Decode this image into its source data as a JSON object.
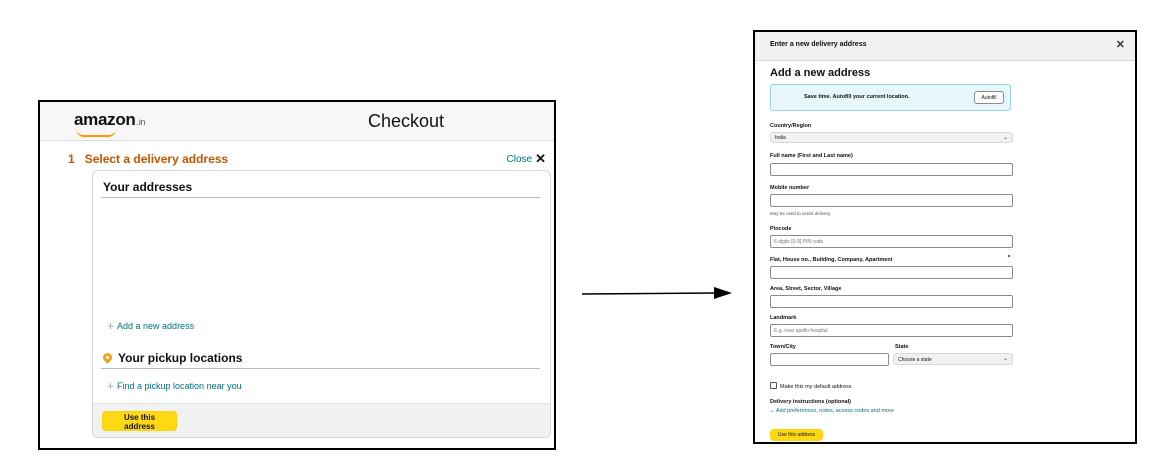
{
  "left": {
    "logo": "amazon",
    "logo_tld": ".in",
    "page_title": "Checkout",
    "step_number": "1",
    "step_title": "Select a delivery address",
    "close_label": "Close",
    "close_glyph": "✕",
    "addresses_heading": "Your addresses",
    "add_address_label": "Add a new address",
    "pickup_heading": "Your pickup locations",
    "pickup_link_label": "Find a pickup location near you",
    "use_address_button": "Use this address"
  },
  "right": {
    "modal_title": "Enter a new delivery address",
    "close_glyph": "✕",
    "heading": "Add a new address",
    "autofill_text": "Save time. Autofill your current location.",
    "autofill_button": "Autofill",
    "country_label": "Country/Region",
    "country_value": "India",
    "fullname_label": "Full name (First and Last name)",
    "mobile_label": "Mobile number",
    "mobile_helper": "May be used to assist delivery",
    "pincode_label": "Pincode",
    "pincode_placeholder": "6 digits [0-9] PIN code",
    "flat_label": "Flat, House no., Building, Company, Apartment",
    "area_label": "Area, Street, Sector, Village",
    "landmark_label": "Landmark",
    "landmark_placeholder": "E.g. near apollo hospital",
    "town_label": "Town/City",
    "state_label": "State",
    "state_value": "Choose a state",
    "default_checkbox_label": "Make this my default address",
    "delivery_instructions_heading": "Delivery instructions (optional)",
    "delivery_instructions_link": "Add preferences, notes, access codes and more",
    "use_address_button": "Use this address"
  },
  "colors": {
    "accent_orange": "#c45500",
    "link_teal": "#007185",
    "button_yellow": "#ffd814",
    "autofill_bg": "#e6f6fb"
  },
  "icons": [
    "close-icon",
    "plus-icon",
    "location-pin-icon",
    "chevron-down-icon",
    "arrow-right-icon"
  ]
}
